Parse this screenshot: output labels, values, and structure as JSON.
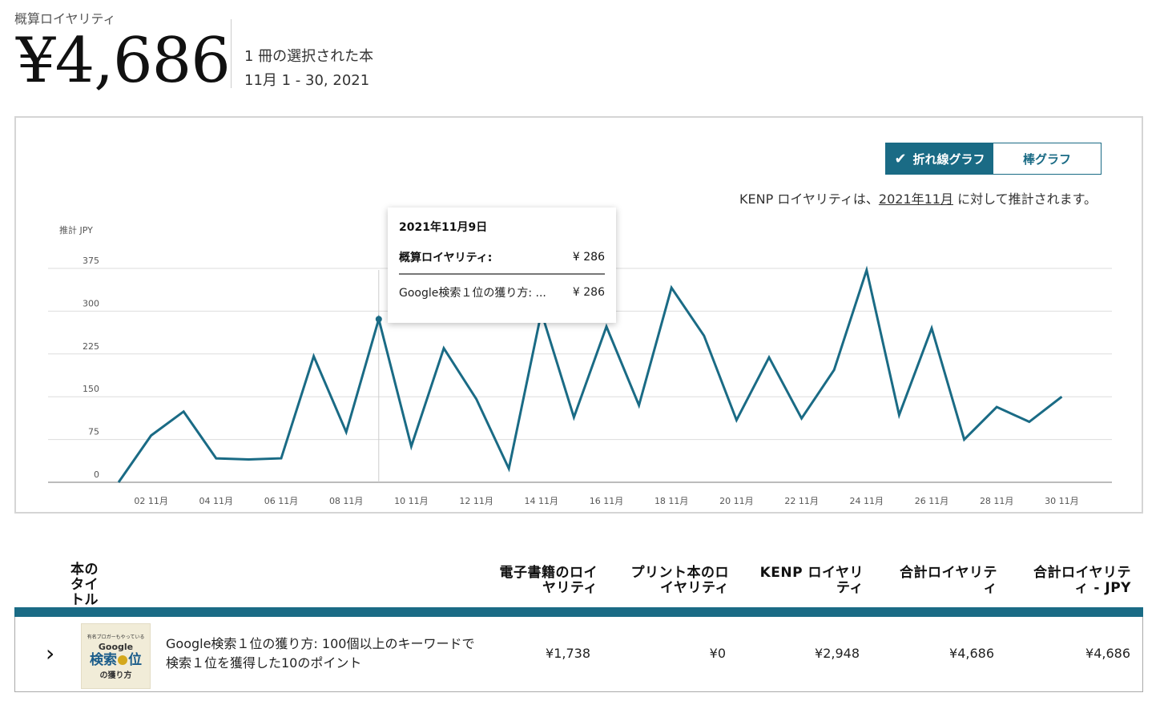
{
  "header": {
    "label": "概算ロイヤリティ",
    "amount": "¥4,686",
    "books_selected": "1 冊の選択された本",
    "date_range": "11月 1 - 30, 2021"
  },
  "chart_panel": {
    "toggle": {
      "line_label": "折れ線グラフ",
      "bar_label": "棒グラフ",
      "selected": "line"
    },
    "kenp_note_prefix": "KENP ロイヤリティは、",
    "kenp_note_link": "2021年11月",
    "kenp_note_suffix": " に対して推計されます。",
    "tooltip": {
      "date": "2021年11月9日",
      "total_label": "概算ロイヤリティ:",
      "total_value": "¥ 286",
      "item_label": "Google検索１位の獲り方: ...",
      "item_value": "¥ 286"
    }
  },
  "chart_data": {
    "type": "line",
    "ylabel": "推計 JPY",
    "ylim": [
      0,
      375
    ],
    "yticks": [
      0,
      75,
      150,
      225,
      300,
      375
    ],
    "x_tick_labels": [
      "02 11月",
      "04 11月",
      "06 11月",
      "08 11月",
      "10 11月",
      "12 11月",
      "14 11月",
      "16 11月",
      "18 11月",
      "20 11月",
      "22 11月",
      "24 11月",
      "26 11月",
      "28 11月",
      "30 11月"
    ],
    "x": [
      1,
      2,
      3,
      4,
      5,
      6,
      7,
      8,
      9,
      10,
      11,
      12,
      13,
      14,
      15,
      16,
      17,
      18,
      19,
      20,
      21,
      22,
      23,
      24,
      25,
      26,
      27,
      28,
      29,
      30
    ],
    "values": [
      0,
      82,
      124,
      42,
      40,
      42,
      221,
      88,
      286,
      63,
      235,
      146,
      24,
      298,
      114,
      273,
      135,
      341,
      257,
      109,
      219,
      112,
      197,
      372,
      118,
      270,
      75,
      132,
      106,
      150
    ],
    "highlight_x": 9,
    "grid": true,
    "color": "#1a6b85"
  },
  "table": {
    "headers": {
      "title": "本のタイトル",
      "ebook": "電子書籍のロイヤリティ",
      "print": "プリント本のロイヤリティ",
      "kenp": "KENP ロイヤリティ",
      "total": "合計ロイヤリティ",
      "total_jpy": "合計ロイヤリティ - JPY"
    },
    "rows": [
      {
        "cover_text_small": "有名ブロガーもやっている",
        "cover_text_google": "Google",
        "cover_text_main_a": "検索",
        "cover_text_main_b": "位",
        "cover_text_sub": "の獲り方",
        "title": "Google検索１位の獲り方: 100個以上のキーワードで検索１位を獲得した10のポイント",
        "ebook": "¥1,738",
        "print": "¥0",
        "kenp": "¥2,948",
        "total": "¥4,686",
        "total_jpy": "¥4,686"
      }
    ]
  }
}
